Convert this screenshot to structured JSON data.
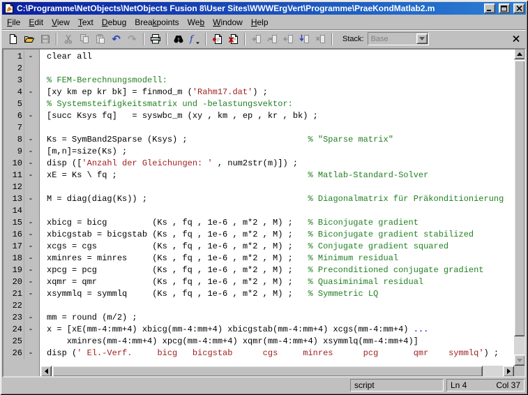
{
  "window": {
    "title": "C:\\Programme\\NetObjects\\NetObjects Fusion 8\\User Sites\\WWWErgVert\\Programme\\PraeKondMatlab2.m",
    "controls": [
      "minimize",
      "maximize",
      "close"
    ],
    "titlebar_colors": {
      "left": "#0a1fa0",
      "right": "#2a7fd4"
    },
    "app_icon": "matlab-document-icon"
  },
  "menubar": {
    "items": [
      {
        "label": "File",
        "underline": 0
      },
      {
        "label": "Edit",
        "underline": 0
      },
      {
        "label": "View",
        "underline": 0
      },
      {
        "label": "Text",
        "underline": 0
      },
      {
        "label": "Debug",
        "underline": 0
      },
      {
        "label": "Breakpoints",
        "underline": 4
      },
      {
        "label": "Web",
        "underline": 2
      },
      {
        "label": "Window",
        "underline": 0
      },
      {
        "label": "Help",
        "underline": 0
      }
    ]
  },
  "toolbar": {
    "stack_label": "Stack:",
    "stack_value": "Base",
    "icons": [
      {
        "name": "new-file-icon",
        "enabled": true
      },
      {
        "name": "open-file-icon",
        "enabled": true
      },
      {
        "name": "save-icon",
        "enabled": false
      },
      {
        "name": "cut-icon",
        "enabled": false
      },
      {
        "name": "copy-icon",
        "enabled": false
      },
      {
        "name": "paste-icon",
        "enabled": false
      },
      {
        "name": "undo-icon",
        "enabled": true
      },
      {
        "name": "redo-icon",
        "enabled": false
      },
      {
        "name": "print-icon",
        "enabled": true
      },
      {
        "name": "find-icon",
        "enabled": true
      },
      {
        "name": "function-list-icon",
        "enabled": true
      },
      {
        "name": "set-clear-breakpoint-icon",
        "enabled": true
      },
      {
        "name": "clear-all-breakpoints-icon",
        "enabled": true
      },
      {
        "name": "step-in-icon",
        "enabled": false
      },
      {
        "name": "step-icon",
        "enabled": false
      },
      {
        "name": "step-out-icon",
        "enabled": false
      },
      {
        "name": "go-until-cursor-icon",
        "enabled": false
      },
      {
        "name": "exit-debug-icon",
        "enabled": false
      },
      {
        "name": "close-editor-icon",
        "enabled": true
      }
    ],
    "undo_glyph": "↶",
    "redo_glyph": "↷"
  },
  "editor": {
    "colors": {
      "code": "#000000",
      "comment": "#228022",
      "string": "#a02020",
      "continuation": "#0000e6",
      "gutter_bg": "#c0c0c0",
      "background": "#ffffff"
    },
    "lines": [
      {
        "n": 1,
        "dash": true,
        "seg": [
          [
            "c",
            "clear all"
          ]
        ]
      },
      {
        "n": 2,
        "dash": false,
        "seg": []
      },
      {
        "n": 3,
        "dash": false,
        "seg": [
          [
            "m",
            "% FEM-Berechnungsmodell:"
          ]
        ]
      },
      {
        "n": 4,
        "dash": true,
        "seg": [
          [
            "c",
            "[xy km ep kr bk] = finmod_m ("
          ],
          [
            "s",
            "'Rahm17.dat'"
          ],
          [
            "c",
            ") ;"
          ]
        ]
      },
      {
        "n": 5,
        "dash": false,
        "seg": [
          [
            "m",
            "% Systemsteifigkeitsmatrix und -belastungsvektor:"
          ]
        ]
      },
      {
        "n": 6,
        "dash": true,
        "seg": [
          [
            "c",
            "[succ Ksys fq]   = syswbc_m (xy , km , ep , kr , bk) ;"
          ]
        ]
      },
      {
        "n": 7,
        "dash": false,
        "seg": []
      },
      {
        "n": 8,
        "dash": true,
        "seg": [
          [
            "c",
            "Ks = SymBand2Sparse (Ksys) ;                        "
          ],
          [
            "m",
            "% \"Sparse matrix\""
          ]
        ]
      },
      {
        "n": 9,
        "dash": true,
        "seg": [
          [
            "c",
            "[m,n]=size(Ks) ;"
          ]
        ]
      },
      {
        "n": 10,
        "dash": true,
        "seg": [
          [
            "c",
            "disp (["
          ],
          [
            "s",
            "'Anzahl der Gleichungen: '"
          ],
          [
            "c",
            " , num2str(m)]) ;"
          ]
        ]
      },
      {
        "n": 11,
        "dash": true,
        "seg": [
          [
            "c",
            "xE = Ks \\ fq ;                                      "
          ],
          [
            "m",
            "% Matlab-Standard-Solver"
          ]
        ]
      },
      {
        "n": 12,
        "dash": false,
        "seg": []
      },
      {
        "n": 13,
        "dash": true,
        "seg": [
          [
            "c",
            "M = diag(diag(Ks)) ;                                "
          ],
          [
            "m",
            "% Diagonalmatrix für Präkonditionierung"
          ]
        ]
      },
      {
        "n": 14,
        "dash": false,
        "seg": []
      },
      {
        "n": 15,
        "dash": true,
        "seg": [
          [
            "c",
            "xbicg = bicg         (Ks , fq , 1e-6 , m*2 , M) ;   "
          ],
          [
            "m",
            "% Biconjugate gradient"
          ]
        ]
      },
      {
        "n": 16,
        "dash": true,
        "seg": [
          [
            "c",
            "xbicgstab = bicgstab (Ks , fq , 1e-6 , m*2 , M) ;   "
          ],
          [
            "m",
            "% Biconjugate gradient stabilized"
          ]
        ]
      },
      {
        "n": 17,
        "dash": true,
        "seg": [
          [
            "c",
            "xcgs = cgs           (Ks , fq , 1e-6 , m*2 , M) ;   "
          ],
          [
            "m",
            "% Conjugate gradient squared"
          ]
        ]
      },
      {
        "n": 18,
        "dash": true,
        "seg": [
          [
            "c",
            "xminres = minres     (Ks , fq , 1e-6 , m*2 , M) ;   "
          ],
          [
            "m",
            "% Minimum residual"
          ]
        ]
      },
      {
        "n": 19,
        "dash": true,
        "seg": [
          [
            "c",
            "xpcg = pcg           (Ks , fq , 1e-6 , m*2 , M) ;   "
          ],
          [
            "m",
            "% Preconditioned conjugate gradient"
          ]
        ]
      },
      {
        "n": 20,
        "dash": true,
        "seg": [
          [
            "c",
            "xqmr = qmr           (Ks , fq , 1e-6 , m*2 , M) ;   "
          ],
          [
            "m",
            "% Quasiminimal residual"
          ]
        ]
      },
      {
        "n": 21,
        "dash": true,
        "seg": [
          [
            "c",
            "xsymmlq = symmlq     (Ks , fq , 1e-6 , m*2 , M) ;   "
          ],
          [
            "m",
            "% Symmetric LQ"
          ]
        ]
      },
      {
        "n": 22,
        "dash": false,
        "seg": []
      },
      {
        "n": 23,
        "dash": true,
        "seg": [
          [
            "c",
            "mm = round (m/2) ;"
          ]
        ]
      },
      {
        "n": 24,
        "dash": true,
        "seg": [
          [
            "c",
            "x = [xE(mm-4:mm+4) xbicg(mm-4:mm+4) xbicgstab(mm-4:mm+4) xcgs(mm-4:mm+4) "
          ],
          [
            "k",
            "..."
          ]
        ]
      },
      {
        "n": 25,
        "dash": false,
        "seg": [
          [
            "c",
            "    xminres(mm-4:mm+4) xpcg(mm-4:mm+4) xqmr(mm-4:mm+4) xsymmlq(mm-4:mm+4)]"
          ]
        ]
      },
      {
        "n": 26,
        "dash": true,
        "seg": [
          [
            "c",
            "disp ("
          ],
          [
            "s",
            "' El.-Verf.     bicg   bicgstab      cgs     minres      pcg       qmr    symmlq'"
          ],
          [
            "c",
            ") ;"
          ]
        ]
      }
    ]
  },
  "statusbar": {
    "mode": "script",
    "line": "Ln 4",
    "col": "Col 37"
  }
}
